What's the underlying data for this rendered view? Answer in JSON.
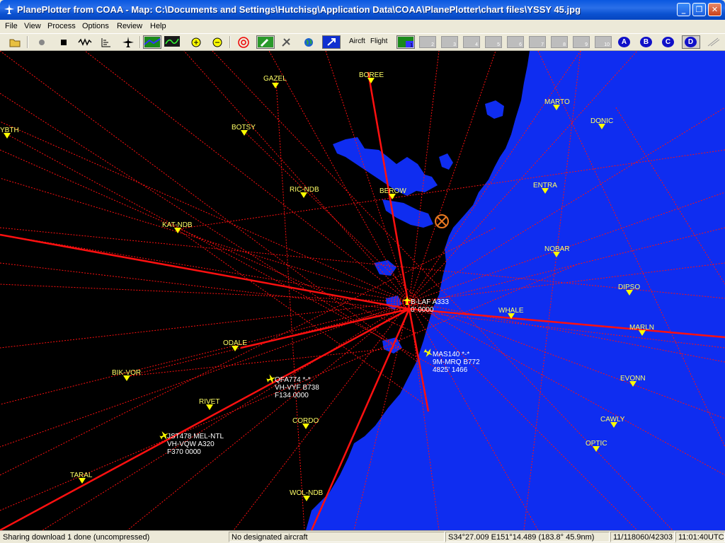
{
  "window": {
    "title": "PlanePlotter from COAA - Map: C:\\Documents and Settings\\Hutchisg\\Application Data\\COAA\\PlanePlotter\\chart files\\YSSY 45.jpg",
    "minimize": "_",
    "maximize": "❐",
    "close": "✕"
  },
  "menu": [
    "File",
    "View",
    "Process",
    "Options",
    "Review",
    "Help"
  ],
  "toolbar": {
    "aircraft_label": "Aircft",
    "flight_label": "Flight",
    "layers": [
      "1",
      "2",
      "3",
      "4",
      "5",
      "6",
      "7",
      "8",
      "9",
      "10"
    ],
    "letters": [
      "A",
      "B",
      "C",
      "D"
    ]
  },
  "waypoints": [
    {
      "name": "GAZEL"
    },
    {
      "name": "BOREE"
    },
    {
      "name": "YBTH"
    },
    {
      "name": "BOTSY"
    },
    {
      "name": "MARTO"
    },
    {
      "name": "DONIC"
    },
    {
      "name": "RIC-NDB"
    },
    {
      "name": "BEROW"
    },
    {
      "name": "ENTRA"
    },
    {
      "name": "KAT-NDB"
    },
    {
      "name": "NOBAR"
    },
    {
      "name": "DIPSO"
    },
    {
      "name": "WHALE"
    },
    {
      "name": "MARLN"
    },
    {
      "name": "ODALE"
    },
    {
      "name": "BIK-VOR"
    },
    {
      "name": "EVONN"
    },
    {
      "name": "RIVET"
    },
    {
      "name": "CAWLY"
    },
    {
      "name": "CORDO"
    },
    {
      "name": "OPTIC"
    },
    {
      "name": "TARAL"
    },
    {
      "name": "WOL-NDB"
    }
  ],
  "aircraft": [
    {
      "lines": [
        "B-LAF A333",
        "0' 0000"
      ]
    },
    {
      "lines": [
        "MAS140 *-*",
        "9M-MRQ B772",
        "4825' 1466"
      ]
    },
    {
      "lines": [
        "QFA774 *-*",
        "VH-VYF B738",
        "F134 0000"
      ]
    },
    {
      "lines": [
        "JST478 MEL-NTL",
        "VH-VQW A320",
        "F370 0000"
      ]
    }
  ],
  "colors": {
    "sea": "#0f2df0",
    "land": "#000000",
    "tracks": "#ff1010",
    "waypoint": "#ffff00",
    "home_marker": "#e87820"
  },
  "status": {
    "left": "Sharing download 1 done (uncompressed)",
    "designated": "No designated aircraft",
    "position": "S34°27.009 E151°14.489 (183.8°   45.9nm)",
    "count": "11/118060/42303",
    "time": "11:01:40UTC"
  }
}
